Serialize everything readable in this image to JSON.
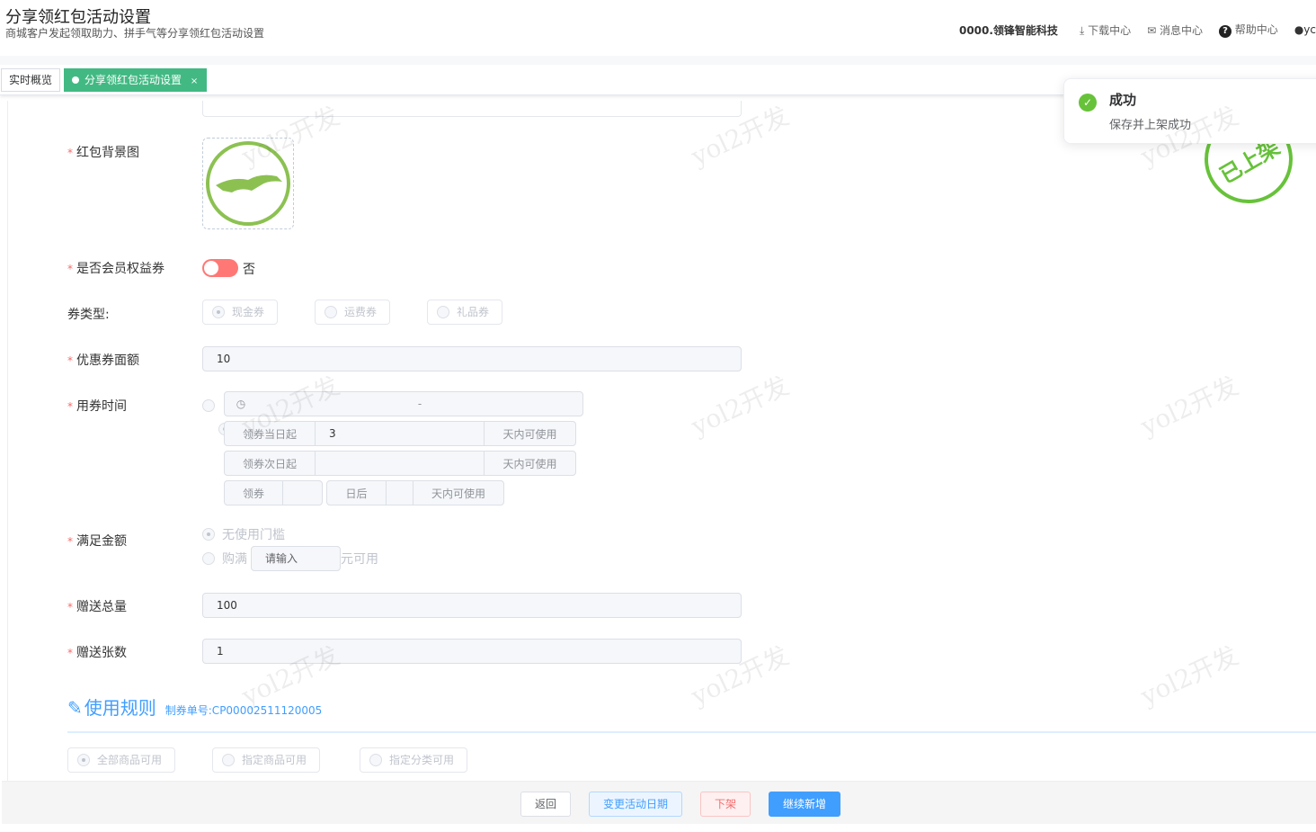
{
  "header": {
    "title": "分享领红包活动设置",
    "subtitle": "商城客户发起领取助力、拼手气等分享领红包活动设置",
    "company": "0000.领锋智能科技",
    "download": "下载中心",
    "messages": "消息中心",
    "help": "帮助中心",
    "user": "yc"
  },
  "tabs": [
    {
      "label": "实时概览"
    },
    {
      "label": "分享领红包活动设置",
      "close": "×"
    }
  ],
  "toast": {
    "title": "成功",
    "message": "保存并上架成功"
  },
  "stamp": "已上架",
  "watermark": "yol2开发",
  "form": {
    "bg_image": "红包背景图",
    "member": {
      "label": "是否会员权益券",
      "value": "否"
    },
    "coupon_type": {
      "label": "券类型:",
      "options": [
        "现金券",
        "运费券",
        "礼品券"
      ]
    },
    "face_value": {
      "label": "优惠券面额",
      "value": "10"
    },
    "use_time": {
      "label": "用券时间",
      "range_sep": "-",
      "opt2_prefix": "领券当日起",
      "opt2_value": "3",
      "suffix": "天内可使用",
      "opt3_prefix": "领券次日起",
      "opt4_prefix": "领券",
      "opt4_mid": "日后"
    },
    "threshold": {
      "label": "满足金额",
      "none": "无使用门槛",
      "full": "购满",
      "placeholder": "请输入",
      "full_suffix": "元可用"
    },
    "total": {
      "label": "赠送总量",
      "value": "100"
    },
    "per": {
      "label": "赠送张数",
      "value": "1"
    }
  },
  "rules": {
    "title": "使用规则",
    "code": "制券单号:CP00002511120005",
    "options": [
      "全部商品可用",
      "指定商品可用",
      "指定分类可用"
    ]
  },
  "footer": {
    "back": "返回",
    "change_date": "变更活动日期",
    "offline": "下架",
    "continue": "继续新增"
  }
}
